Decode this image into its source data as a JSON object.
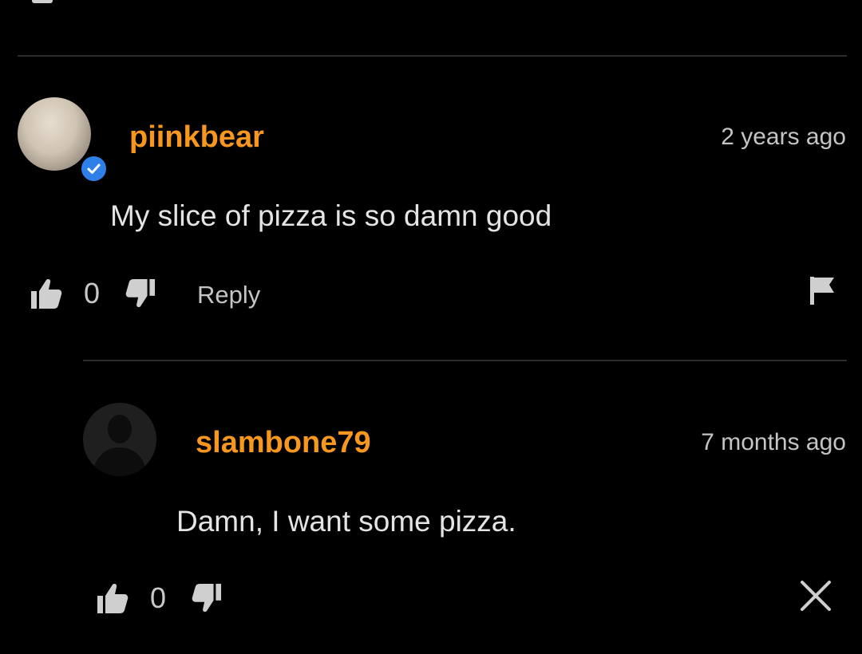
{
  "comments": [
    {
      "username": "piinkbear",
      "verified": true,
      "time": "2 years ago",
      "text": "My slice of pizza is so damn good",
      "likes": "0",
      "reply_label": "Reply"
    },
    {
      "username": "slambone79",
      "verified": false,
      "time": "7 months ago",
      "text": "Damn, I want some pizza.",
      "likes": "0"
    }
  ],
  "colors": {
    "background": "#000000",
    "username": "#f7971d",
    "verified_badge": "#2f7fe8",
    "divider": "#2c2c2c"
  },
  "icons": {
    "like": "thumbs-up-icon",
    "dislike": "thumbs-down-icon",
    "flag": "flag-icon",
    "close": "close-icon",
    "verified": "checkmark-icon"
  }
}
